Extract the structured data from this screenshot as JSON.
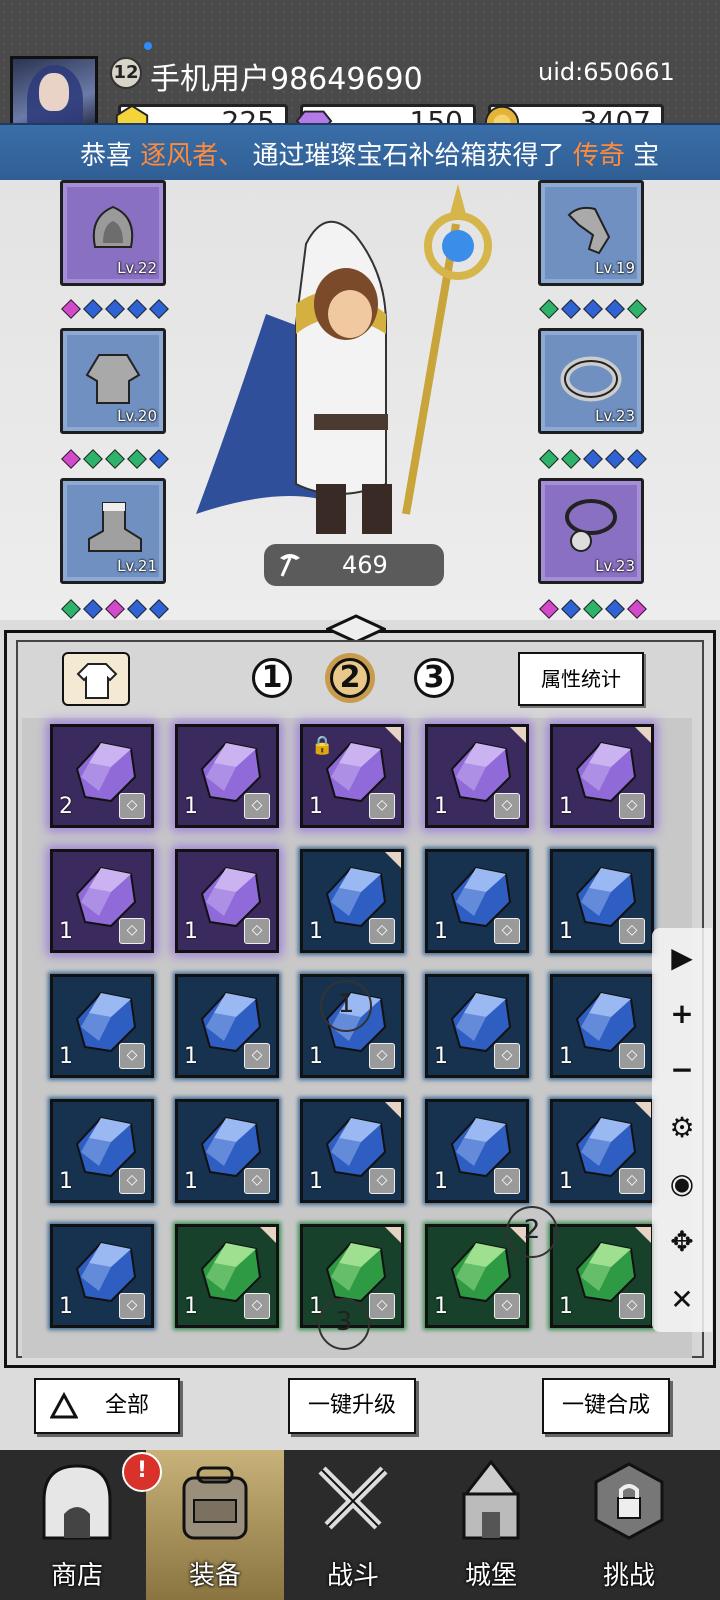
{
  "profile": {
    "level": "12",
    "username": "手机用户98649690",
    "uid": "uid:650661"
  },
  "resources": {
    "gold_coin_top": "225",
    "purple_gem": "150",
    "coin": "3407"
  },
  "banner": {
    "prefix": "恭喜 ",
    "player": "逐风者、",
    "middle": " 通过璀璨宝石补给箱获得了 ",
    "rarity": "传奇",
    "suffix": " 宝"
  },
  "equipment": {
    "left": [
      {
        "slot": "helmet",
        "level": "Lv.22",
        "rarity": "purple",
        "gems": [
          "p",
          "b",
          "b",
          "b",
          "b"
        ]
      },
      {
        "slot": "armor",
        "level": "Lv.20",
        "rarity": "blue",
        "gems": [
          "p",
          "g",
          "g",
          "g",
          "b"
        ]
      },
      {
        "slot": "boots",
        "level": "Lv.21",
        "rarity": "blue",
        "gems": [
          "g",
          "b",
          "p",
          "b",
          "b"
        ]
      }
    ],
    "right": [
      {
        "slot": "gloves",
        "level": "Lv.19",
        "rarity": "blue",
        "gems": [
          "g",
          "b",
          "b",
          "b",
          "g"
        ]
      },
      {
        "slot": "ring",
        "level": "Lv.23",
        "rarity": "blue",
        "gems": [
          "g",
          "g",
          "b",
          "b",
          "b"
        ]
      },
      {
        "slot": "necklace",
        "level": "Lv.23",
        "rarity": "purple",
        "gems": [
          "p",
          "b",
          "g",
          "b",
          "p"
        ]
      }
    ],
    "power": "469"
  },
  "panel": {
    "tabs": [
      "1",
      "2",
      "3"
    ],
    "active_tab": "2",
    "stat_button": "属性统计"
  },
  "inventory": [
    {
      "color": "purple",
      "count": "2",
      "tag": "ring-icon"
    },
    {
      "color": "purple",
      "count": "1",
      "tag": "armor-icon"
    },
    {
      "color": "purple",
      "count": "1",
      "tag": "gloves-icon",
      "locked": true,
      "corner": true
    },
    {
      "color": "purple",
      "count": "1",
      "tag": "gloves-icon",
      "corner": true
    },
    {
      "color": "purple",
      "count": "1",
      "tag": "helmet-icon",
      "corner": true
    },
    {
      "color": "purple",
      "count": "1",
      "tag": "helmet-icon"
    },
    {
      "color": "purple",
      "count": "1",
      "tag": "necklace-icon"
    },
    {
      "color": "blue",
      "count": "1",
      "tag": "ring-icon",
      "corner": true
    },
    {
      "color": "blue",
      "count": "1",
      "tag": "armor-icon"
    },
    {
      "color": "blue",
      "count": "1",
      "tag": "armor-icon"
    },
    {
      "color": "blue",
      "count": "1",
      "tag": "armor-icon"
    },
    {
      "color": "blue",
      "count": "1",
      "tag": "armor-icon"
    },
    {
      "color": "blue",
      "count": "1",
      "tag": "boots-icon"
    },
    {
      "color": "blue",
      "count": "1",
      "tag": "helmet-icon"
    },
    {
      "color": "blue",
      "count": "1",
      "tag": "helmet-icon"
    },
    {
      "color": "blue",
      "count": "1",
      "tag": "necklace-icon"
    },
    {
      "color": "blue",
      "count": "1",
      "tag": "necklace-icon"
    },
    {
      "color": "blue",
      "count": "1",
      "tag": "necklace-icon",
      "corner": true
    },
    {
      "color": "blue",
      "count": "1",
      "tag": "necklace-icon"
    },
    {
      "color": "blue",
      "count": "1",
      "tag": "necklace-icon",
      "corner": true
    },
    {
      "color": "blue",
      "count": "1",
      "tag": "necklace-icon"
    },
    {
      "color": "green",
      "count": "1",
      "tag": "ring-icon",
      "corner": true
    },
    {
      "color": "green",
      "count": "1",
      "tag": "armor-icon",
      "corner": true
    },
    {
      "color": "green",
      "count": "1",
      "tag": "armor-icon",
      "corner": true
    },
    {
      "color": "green",
      "count": "1",
      "tag": "boots-icon",
      "corner": true
    }
  ],
  "markers": [
    "1",
    "2",
    "3"
  ],
  "tools": [
    "play-icon",
    "plus-icon",
    "minus-icon",
    "gear-icon",
    "eye-off-icon",
    "move-icon",
    "close-icon"
  ],
  "actions": {
    "filter": "全部",
    "upgrade_all": "一键升级",
    "merge_all": "一键合成"
  },
  "nav": [
    {
      "label": "商店",
      "icon": "shop-icon"
    },
    {
      "label": "装备",
      "icon": "backpack-icon",
      "active": true,
      "badge": "!"
    },
    {
      "label": "战斗",
      "icon": "swords-icon"
    },
    {
      "label": "城堡",
      "icon": "castle-icon"
    },
    {
      "label": "挑战",
      "icon": "challenge-icon"
    }
  ]
}
